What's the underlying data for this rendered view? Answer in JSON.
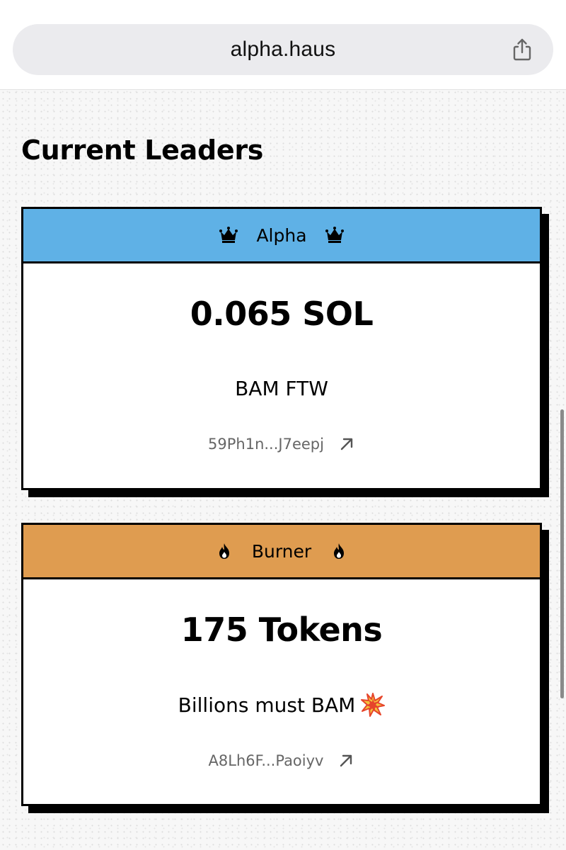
{
  "browser": {
    "url": "alpha.haus"
  },
  "page": {
    "section_title": "Current Leaders"
  },
  "leaders": [
    {
      "category": "Alpha",
      "icon": "crown-icon",
      "header_color": "#5fb1e6",
      "value": "0.065 SOL",
      "message": "BAM FTW",
      "address": "59Ph1n...J7eepj"
    },
    {
      "category": "Burner",
      "icon": "fire-icon",
      "header_color": "#df9c50",
      "value": "175 Tokens",
      "message": "Billions must BAM",
      "message_icon": "collision-icon",
      "address": "A8Lh6F...Paoiyv"
    }
  ]
}
